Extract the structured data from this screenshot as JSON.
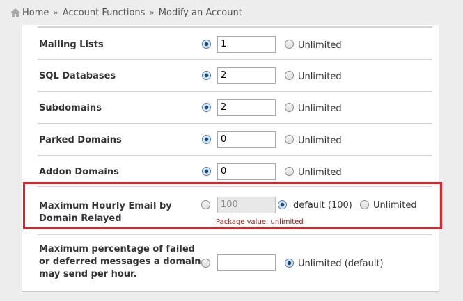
{
  "breadcrumb": {
    "home": "Home",
    "separator": "»",
    "item1": "Account Functions",
    "item2": "Modify an Account"
  },
  "rows": [
    {
      "label": "Mailing Lists",
      "value": "1",
      "unlimited": "Unlimited"
    },
    {
      "label": "SQL Databases",
      "value": "2",
      "unlimited": "Unlimited"
    },
    {
      "label": "Subdomains",
      "value": "2",
      "unlimited": "Unlimited"
    },
    {
      "label": "Parked Domains",
      "value": "0",
      "unlimited": "Unlimited"
    },
    {
      "label": "Addon Domains",
      "value": "0",
      "unlimited": "Unlimited"
    }
  ],
  "hourly_email": {
    "label_line1": "Maximum Hourly Email by",
    "label_line2": "Domain Relayed",
    "placeholder": "100",
    "default_label": "default (100)",
    "unlimited": "Unlimited",
    "package_note": "Package value: unlimited"
  },
  "failed_pct": {
    "label_line1": "Maximum percentage of failed",
    "label_line2": "or deferred messages a domain",
    "label_line3": "may send per hour.",
    "unlimited_default": "Unlimited (default)"
  },
  "colors": {
    "highlight": "#d9262c",
    "note": "#8b1a1a"
  }
}
